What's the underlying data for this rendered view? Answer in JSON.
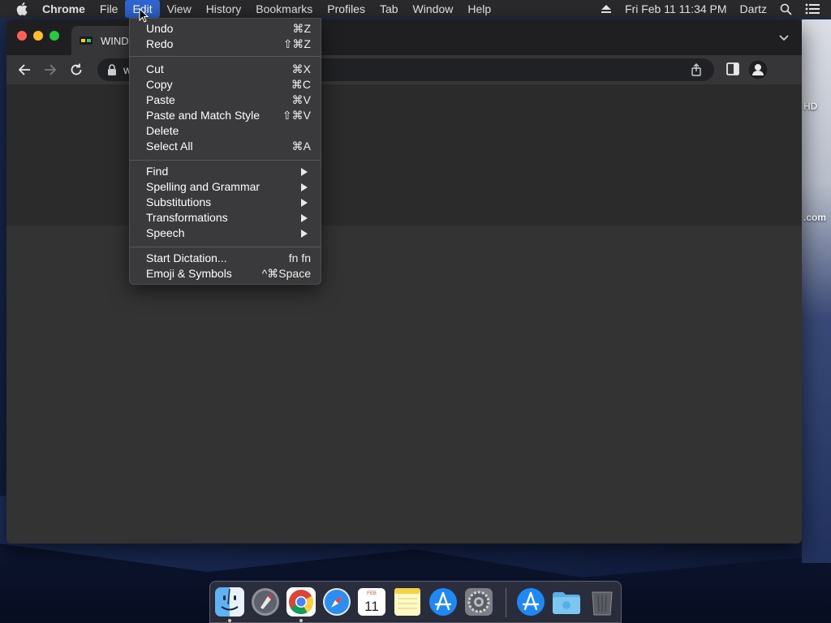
{
  "menubar": {
    "app_name": "Chrome",
    "menus": [
      "File",
      "Edit",
      "View",
      "History",
      "Bookmarks",
      "Profiles",
      "Tab",
      "Window",
      "Help"
    ],
    "active_menu": "Edit",
    "datetime": "Fri Feb 11  11:34 PM",
    "user": "Dartz",
    "icons": [
      "apple-icon",
      "eject-icon",
      "search-icon",
      "control-center-icon"
    ]
  },
  "browser": {
    "tab_title": "WINDO",
    "url_fragment": "w",
    "icons": [
      "back-icon",
      "forward-icon",
      "reload-icon",
      "lock-icon",
      "share-icon",
      "side-panel-icon",
      "profile-icon",
      "chevron-down-icon"
    ]
  },
  "edit_menu": {
    "items": [
      {
        "label": "Undo",
        "shortcut": "⌘Z"
      },
      {
        "label": "Redo",
        "shortcut": "⇧⌘Z"
      },
      {
        "label": "Cut",
        "shortcut": "⌘X"
      },
      {
        "label": "Copy",
        "shortcut": "⌘C"
      },
      {
        "label": "Paste",
        "shortcut": "⌘V"
      },
      {
        "label": "Paste and Match Style",
        "shortcut": "⇧⌘V"
      },
      {
        "label": "Delete",
        "shortcut": ""
      },
      {
        "label": "Select All",
        "shortcut": "⌘A"
      },
      {
        "label": "Find",
        "submenu": true
      },
      {
        "label": "Spelling and Grammar",
        "submenu": true
      },
      {
        "label": "Substitutions",
        "submenu": true
      },
      {
        "label": "Transformations",
        "submenu": true
      },
      {
        "label": "Speech",
        "submenu": true
      },
      {
        "label": "Start Dictation...",
        "shortcut": "fn fn"
      },
      {
        "label": "Emoji & Symbols",
        "shortcut": "^⌘Space"
      }
    ]
  },
  "desktop": {
    "text_top": "HD",
    "text_bottom": ".com"
  },
  "dock": {
    "apps": [
      "Finder",
      "Launchpad",
      "Google Chrome",
      "Safari",
      "Calendar",
      "Notes",
      "App Store",
      "System Preferences",
      "App Store",
      "Downloads",
      "Trash"
    ],
    "calendar_month": "FEB",
    "calendar_day": "11"
  },
  "colors": {
    "menu_highlight": "#2f66d1",
    "menubar_bg": "#2a2a2c",
    "window_bg": "#323233"
  }
}
